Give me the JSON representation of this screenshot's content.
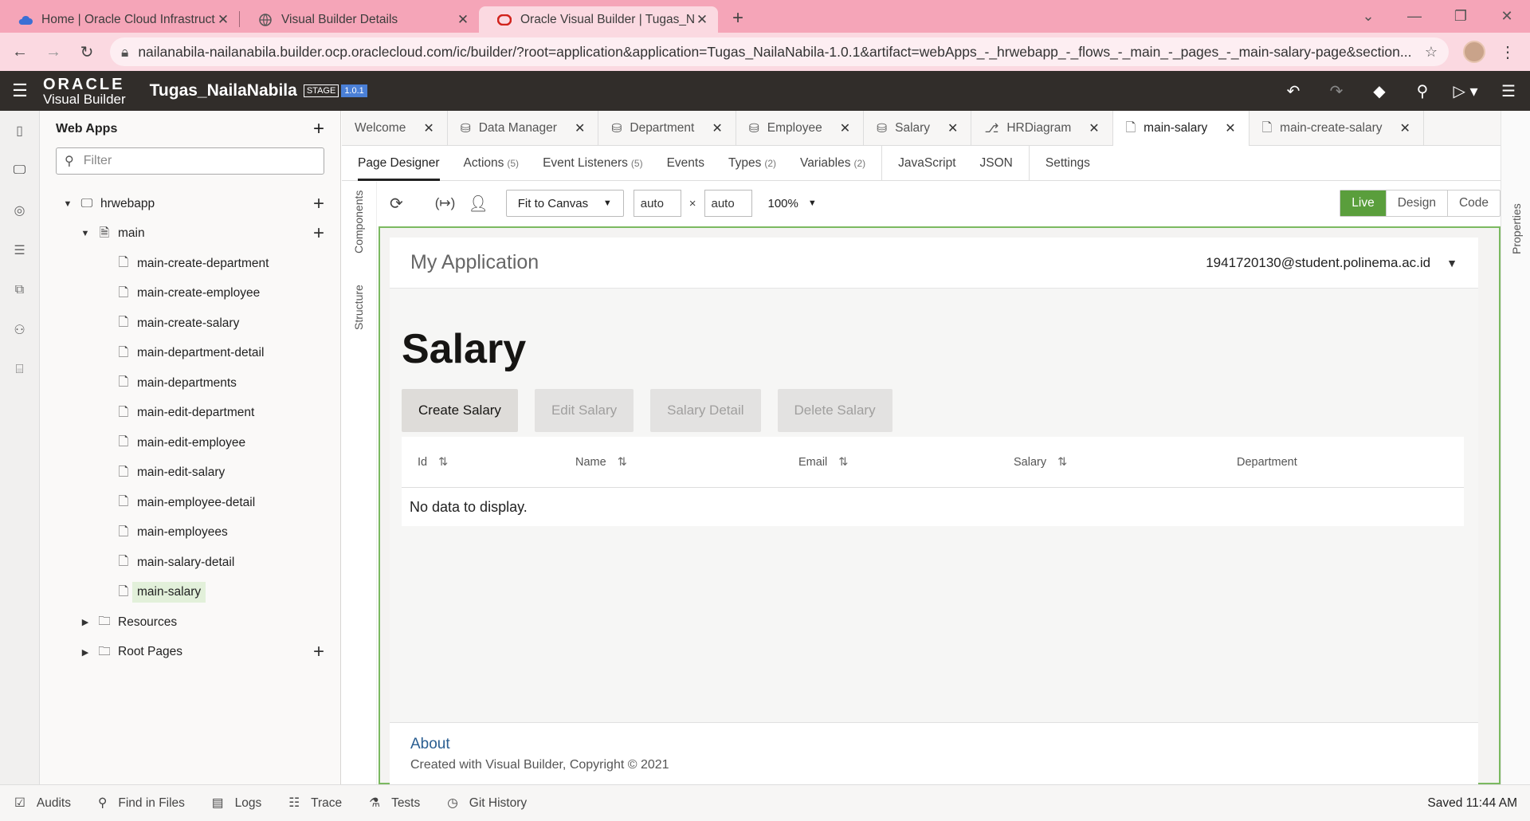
{
  "browser": {
    "tabs": [
      {
        "title": "Home | Oracle Cloud Infrastructu"
      },
      {
        "title": "Visual Builder Details"
      },
      {
        "title": "Oracle Visual Builder | Tugas_Nai"
      }
    ],
    "url": "nailanabila-nailanabila.builder.ocp.oraclecloud.com/ic/builder/?root=application&application=Tugas_NailaNabila-1.0.1&artifact=webApps_-_hrwebapp_-_flows_-_main_-_pages_-_main-salary-page&section..."
  },
  "header": {
    "logo_top": "ORACLE",
    "logo_bottom": "Visual Builder",
    "app_name": "Tugas_NailaNabila",
    "stage": "STAGE",
    "version": "1.0.1"
  },
  "navigator": {
    "title": "Web Apps",
    "filter_placeholder": "Filter",
    "root": "hrwebapp",
    "flow": "main",
    "pages": [
      "main-create-department",
      "main-create-employee",
      "main-create-salary",
      "main-department-detail",
      "main-departments",
      "main-edit-department",
      "main-edit-employee",
      "main-edit-salary",
      "main-employee-detail",
      "main-employees",
      "main-salary-detail",
      "main-salary"
    ],
    "resources": "Resources",
    "root_pages": "Root Pages"
  },
  "editor_tabs": [
    {
      "label": "Welcome"
    },
    {
      "label": "Data Manager"
    },
    {
      "label": "Department"
    },
    {
      "label": "Employee"
    },
    {
      "label": "Salary"
    },
    {
      "label": "HRDiagram"
    },
    {
      "label": "main-salary"
    },
    {
      "label": "main-create-salary"
    }
  ],
  "sub_tabs": {
    "page_designer": "Page Designer",
    "actions": "Actions",
    "actions_count": "(5)",
    "event_listeners": "Event Listeners",
    "event_listeners_count": "(5)",
    "events": "Events",
    "types": "Types",
    "types_count": "(2)",
    "variables": "Variables",
    "variables_count": "(2)",
    "javascript": "JavaScript",
    "json": "JSON",
    "settings": "Settings"
  },
  "side_labels": {
    "components": "Components",
    "structure": "Structure",
    "properties": "Properties"
  },
  "toolbar": {
    "fit": "Fit to Canvas",
    "width": "auto",
    "height": "auto",
    "times": "×",
    "zoom": "100%",
    "modes": [
      "Live",
      "Design",
      "Code"
    ]
  },
  "app_preview": {
    "app_title": "My Application",
    "user": "1941720130@student.polinema.ac.id",
    "page_title": "Salary",
    "buttons": {
      "create": "Create Salary",
      "edit": "Edit Salary",
      "detail": "Salary Detail",
      "delete": "Delete Salary"
    },
    "columns": [
      "Id",
      "Name",
      "Email",
      "Salary",
      "Department"
    ],
    "no_data": "No data to display.",
    "footer_link": "About",
    "footer_text": "Created with Visual Builder, Copyright © 2021"
  },
  "status_bar": {
    "audits": "Audits",
    "find": "Find in Files",
    "logs": "Logs",
    "trace": "Trace",
    "tests": "Tests",
    "git": "Git History",
    "saved": "Saved 11:44 AM"
  },
  "colors": {
    "accent_green": "#5a9e3c",
    "header_bg": "#312d2a",
    "browser_pink": "#f5a5b8"
  }
}
